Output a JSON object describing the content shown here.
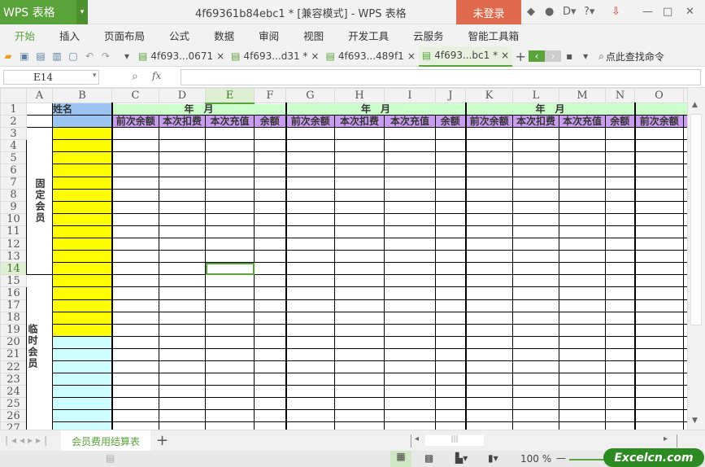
{
  "app": {
    "name": "WPS 表格",
    "doc_title": "4f69361b84ebc1 * [兼容模式] - WPS 表格",
    "login": "未登录",
    "accent": "#5aa23a"
  },
  "menu": [
    "开始",
    "插入",
    "页面布局",
    "公式",
    "数据",
    "审阅",
    "视图",
    "开发工具",
    "云服务",
    "智能工具箱"
  ],
  "doc_tabs": [
    {
      "label": "4f693...0671",
      "active": false
    },
    {
      "label": "4f693...d31 *",
      "active": false
    },
    {
      "label": "4f693...489f1",
      "active": false
    },
    {
      "label": "4f693...bc1 *",
      "active": true
    }
  ],
  "search_cmd": "点此查找命令",
  "formula": {
    "cell_ref": "E14",
    "fx": "fx",
    "value": ""
  },
  "columns": [
    "A",
    "B",
    "C",
    "D",
    "E",
    "F",
    "G",
    "H",
    "I",
    "J",
    "K",
    "L",
    "M",
    "N",
    "O"
  ],
  "selected_col": "E",
  "selected_row": 14,
  "sheet": {
    "name_header": "姓名",
    "month_header": "年　月",
    "sub_headers": [
      "前次余额",
      "本次扣费",
      "本次充值",
      "余额"
    ],
    "group_fixed": "固定会员",
    "group_temp": "临时会员"
  },
  "sheet_tabs": [
    "会员费用结算表"
  ],
  "zoom": "100 %",
  "watermark": "Excelcn.com"
}
